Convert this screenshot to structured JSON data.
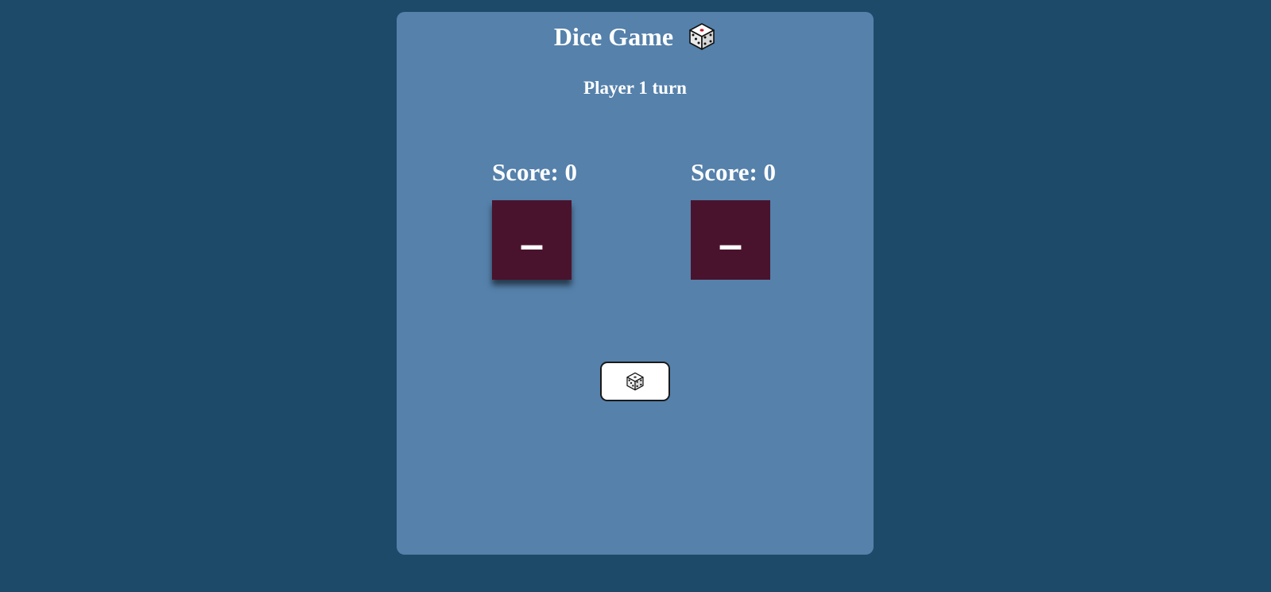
{
  "header": {
    "title": "Dice Game",
    "title_icon": "dice-icon"
  },
  "status": {
    "turn_text": "Player 1 turn"
  },
  "players": [
    {
      "score_text": "Score: 0",
      "die_value": "–",
      "active": true
    },
    {
      "score_text": "Score: 0",
      "die_value": "–",
      "active": false
    }
  ],
  "controls": {
    "roll_button_icon": "dice-icon"
  },
  "colors": {
    "page_background": "#1d4a68",
    "card_background": "#5581ab",
    "die_background": "#4a132d",
    "text": "#ffffff"
  }
}
